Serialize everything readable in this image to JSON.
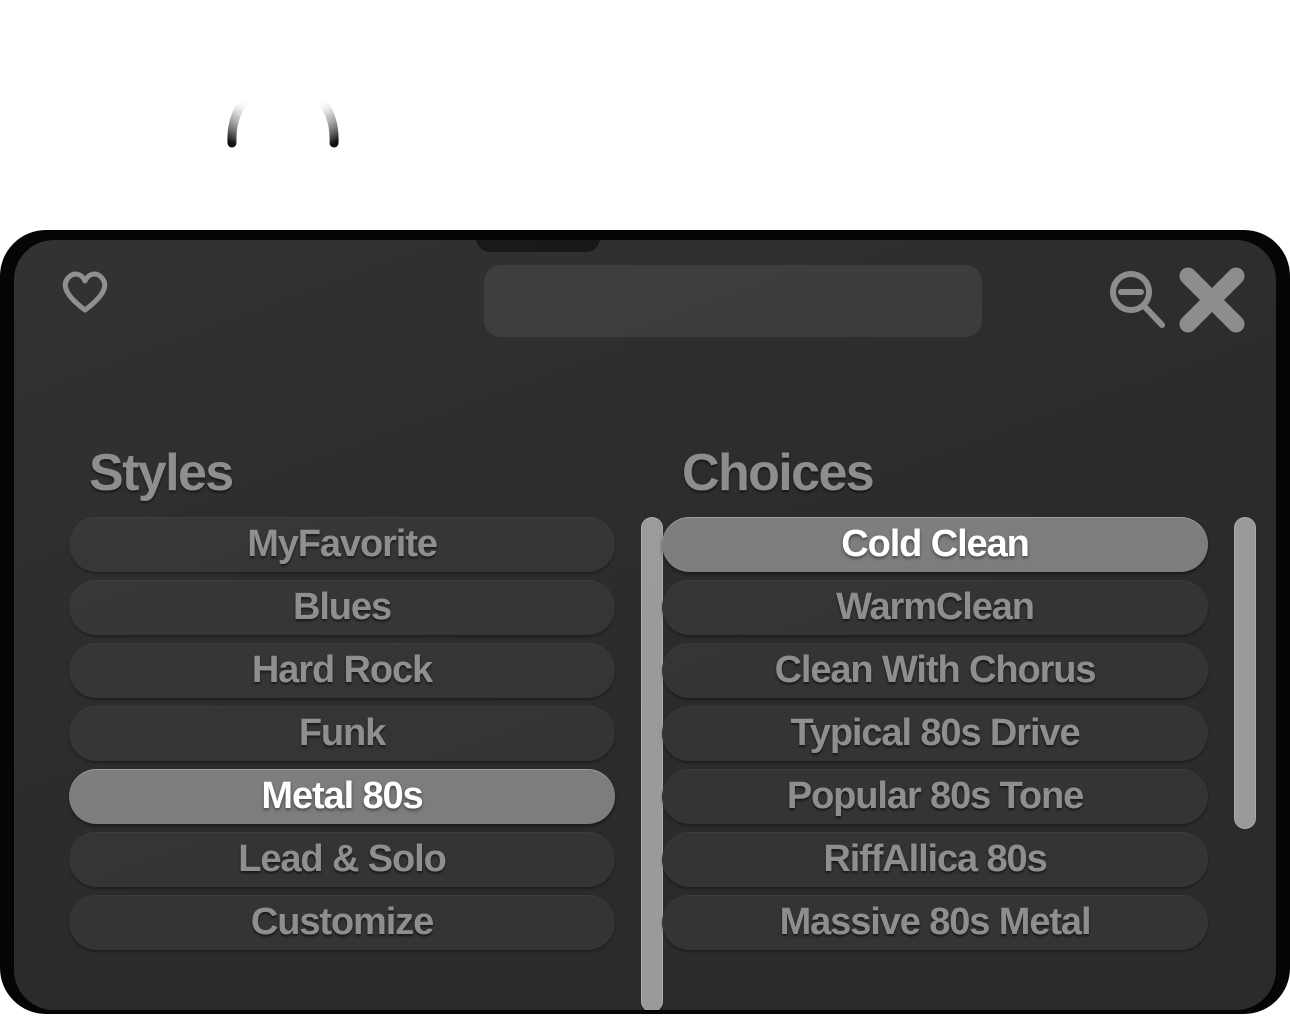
{
  "dialog": {
    "topbar": {
      "favorite_icon": "heart-icon",
      "zoom_out_icon": "magnifier-minus-icon",
      "close_icon": "close-x-icon",
      "title_value": "",
      "title_placeholder": ""
    },
    "columns": [
      {
        "heading": "Styles",
        "items": [
          {
            "label": "MyFavorite",
            "selected": false
          },
          {
            "label": "Blues",
            "selected": false
          },
          {
            "label": "Hard Rock",
            "selected": false
          },
          {
            "label": "Funk",
            "selected": false
          },
          {
            "label": "Metal 80s",
            "selected": true
          },
          {
            "label": "Lead & Solo",
            "selected": false
          },
          {
            "label": "Customize",
            "selected": false
          }
        ],
        "scrollbar": {
          "thumb_top_pct": 0,
          "thumb_height_pct": 100
        }
      },
      {
        "heading": "Choices",
        "items": [
          {
            "label": "Cold Clean",
            "selected": true
          },
          {
            "label": "WarmClean",
            "selected": false
          },
          {
            "label": "Clean With Chorus",
            "selected": false
          },
          {
            "label": "Typical 80s Drive",
            "selected": false
          },
          {
            "label": "Popular 80s Tone",
            "selected": false
          },
          {
            "label": "RiffAllica 80s",
            "selected": false
          },
          {
            "label": "Massive 80s Metal",
            "selected": false
          }
        ],
        "scrollbar": {
          "thumb_top_pct": 0,
          "thumb_height_pct": 63
        }
      }
    ]
  },
  "colors": {
    "panel_bg": "#2b2b2b",
    "shell_bg": "#050505",
    "item_bg": "#343434",
    "item_text": "#8e8e8e",
    "item_selected_bg": "#7d7d7d",
    "item_selected_text": "#ffffff",
    "heading_text": "#8c8c8c",
    "icon_color": "#8c8c8c",
    "scrollbar_thumb": "#9a9a9a",
    "field_bg": "#3a3a3a",
    "page_bg": "#ffffff"
  }
}
